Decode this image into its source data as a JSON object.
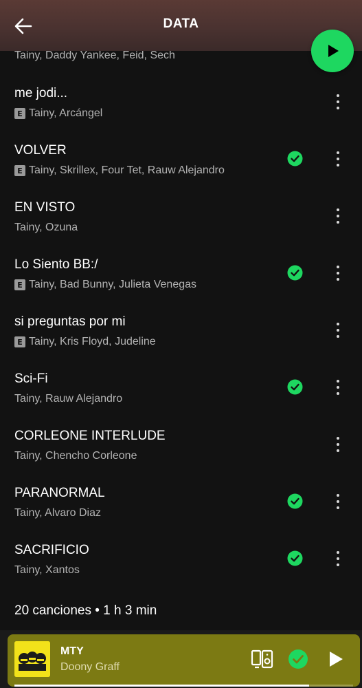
{
  "header": {
    "title": "DATA"
  },
  "partial_row": {
    "artists": "Tainy, Daddy Yankee, Feid, Sech"
  },
  "tracks": [
    {
      "title": "me jodi...",
      "artists": "Tainy, Arcángel",
      "explicit": true,
      "downloaded": false
    },
    {
      "title": "VOLVER",
      "artists": "Tainy, Skrillex, Four Tet, Rauw Alejandro",
      "explicit": true,
      "downloaded": true
    },
    {
      "title": "EN VISTO",
      "artists": "Tainy, Ozuna",
      "explicit": false,
      "downloaded": false
    },
    {
      "title": "Lo Siento BB:/",
      "artists": "Tainy, Bad Bunny, Julieta Venegas",
      "explicit": true,
      "downloaded": true
    },
    {
      "title": "si preguntas por mi",
      "artists": "Tainy, Kris Floyd, Judeline",
      "explicit": true,
      "downloaded": false
    },
    {
      "title": "Sci-Fi",
      "artists": "Tainy, Rauw Alejandro",
      "explicit": false,
      "downloaded": true
    },
    {
      "title": "CORLEONE INTERLUDE",
      "artists": "Tainy, Chencho Corleone",
      "explicit": false,
      "downloaded": false
    },
    {
      "title": "PARANORMAL",
      "artists": "Tainy, Alvaro Diaz",
      "explicit": false,
      "downloaded": true
    },
    {
      "title": "SACRIFICIO",
      "artists": "Tainy, Xantos",
      "explicit": false,
      "downloaded": true
    }
  ],
  "explicit_label": "E",
  "summary": "20 canciones • 1 h 3 min",
  "now_playing": {
    "title": "MTY",
    "artist": "Doony Graff",
    "progress": 0.87,
    "downloaded": true
  },
  "colors": {
    "accent": "#1ed760",
    "background": "#121212",
    "mini_player": "#7c7a13",
    "header_top": "#5a3a35"
  },
  "icons": {
    "back": "arrow-left-icon",
    "play": "play-icon",
    "downloaded": "check-circle-icon",
    "more": "more-vertical-icon",
    "devices": "devices-icon"
  }
}
